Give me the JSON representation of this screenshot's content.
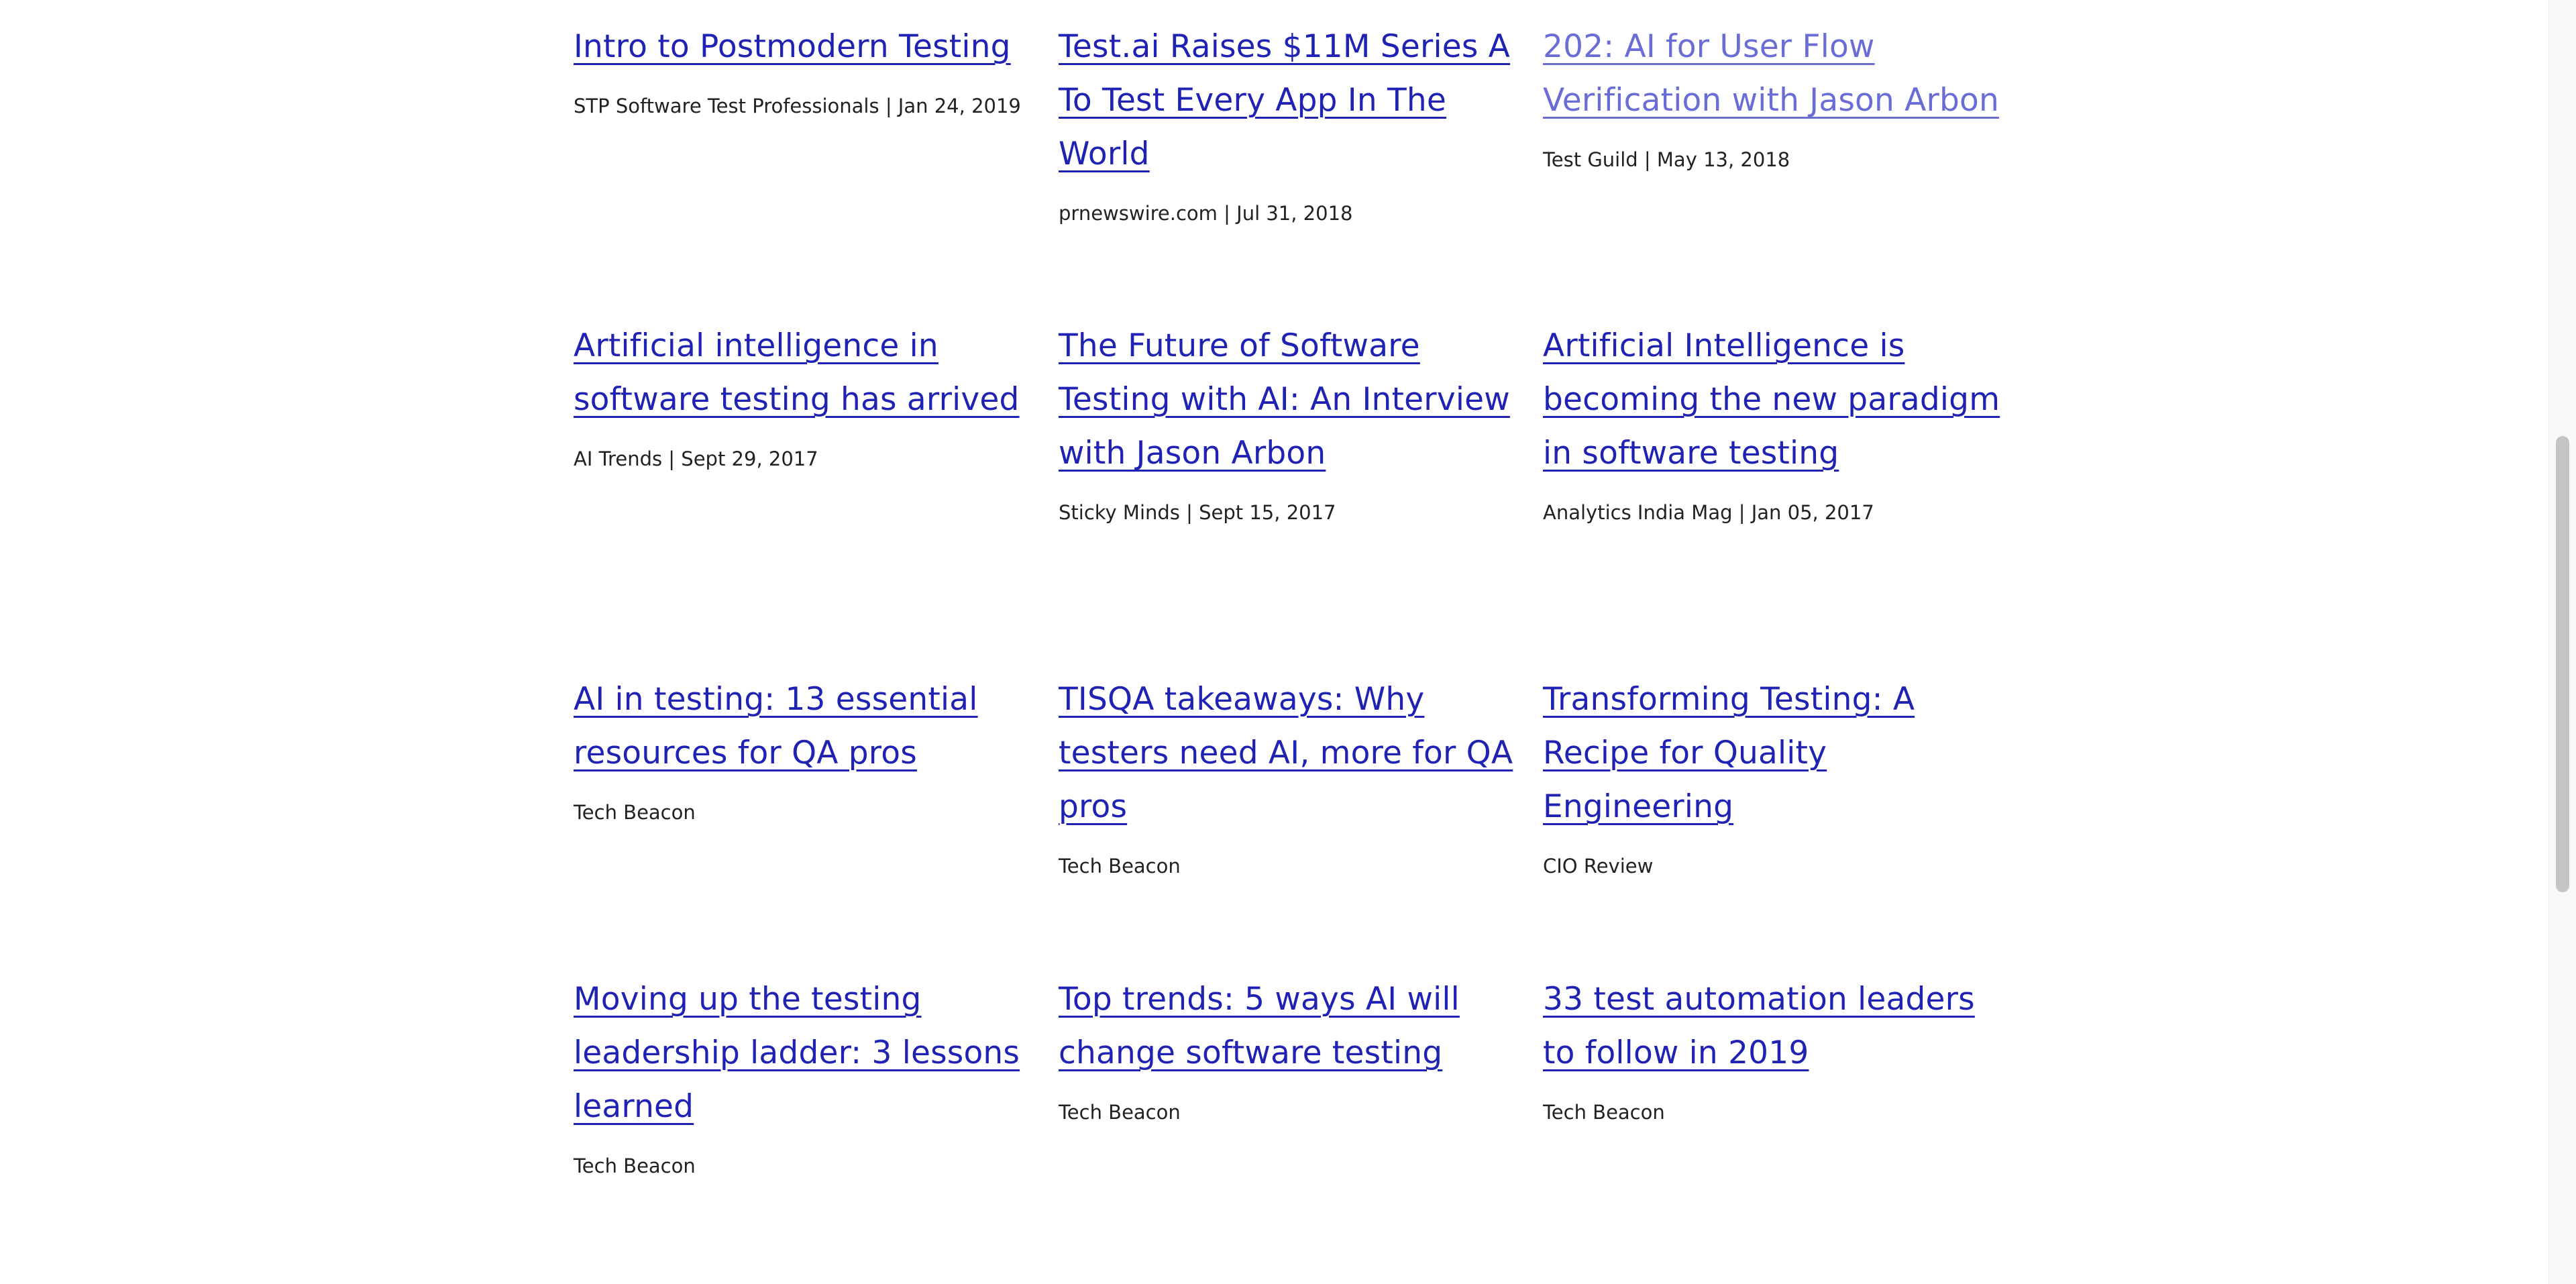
{
  "articles": [
    {
      "title": "Intro to Postmodern Testing",
      "meta": "STP Software Test Professionals  |  Jan 24, 2019",
      "visited": false
    },
    {
      "title": "Test.ai Raises $11M Series A To Test Every App In The World",
      "meta": "prnewswire.com  |  Jul 31, 2018",
      "visited": false
    },
    {
      "title": "202: AI for User Flow Verification with Jason Arbon",
      "meta": "Test Guild | May 13, 2018",
      "visited": true
    },
    {
      "title": "Artificial intelligence in software testing has arrived",
      "meta": "AI Trends  |  Sept 29, 2017",
      "visited": false
    },
    {
      "title": "The Future of Software Testing with AI: An Interview with Jason Arbon",
      "meta": "Sticky Minds  | Sept 15, 2017",
      "visited": false
    },
    {
      "title": "Artificial Intelligence is becoming the new paradigm in software testing",
      "meta": "Analytics India Mag | Jan 05, 2017",
      "visited": false
    },
    {
      "title": "AI in testing: 13 essential resources for QA pros",
      "meta": "Tech Beacon",
      "visited": false
    },
    {
      "title": "TISQA takeaways: Why testers need AI, more for QA pros",
      "meta": "Tech Beacon",
      "visited": false
    },
    {
      "title": "Transforming Testing: A Recipe for Quality Engineering",
      "meta": "CIO Review",
      "visited": false
    },
    {
      "title": "Moving up the testing leadership ladder: 3 lessons learned",
      "meta": "Tech Beacon",
      "visited": false
    },
    {
      "title": "Top trends: 5 ways AI will change software testing",
      "meta": "Tech Beacon",
      "visited": false
    },
    {
      "title": "33 test automation leaders to follow in 2019",
      "meta": "Tech Beacon",
      "visited": false
    }
  ],
  "colors": {
    "link": "#1f22b3",
    "link_visited": "#6a6dd6",
    "meta_text": "#222222",
    "background": "#ffffff"
  }
}
